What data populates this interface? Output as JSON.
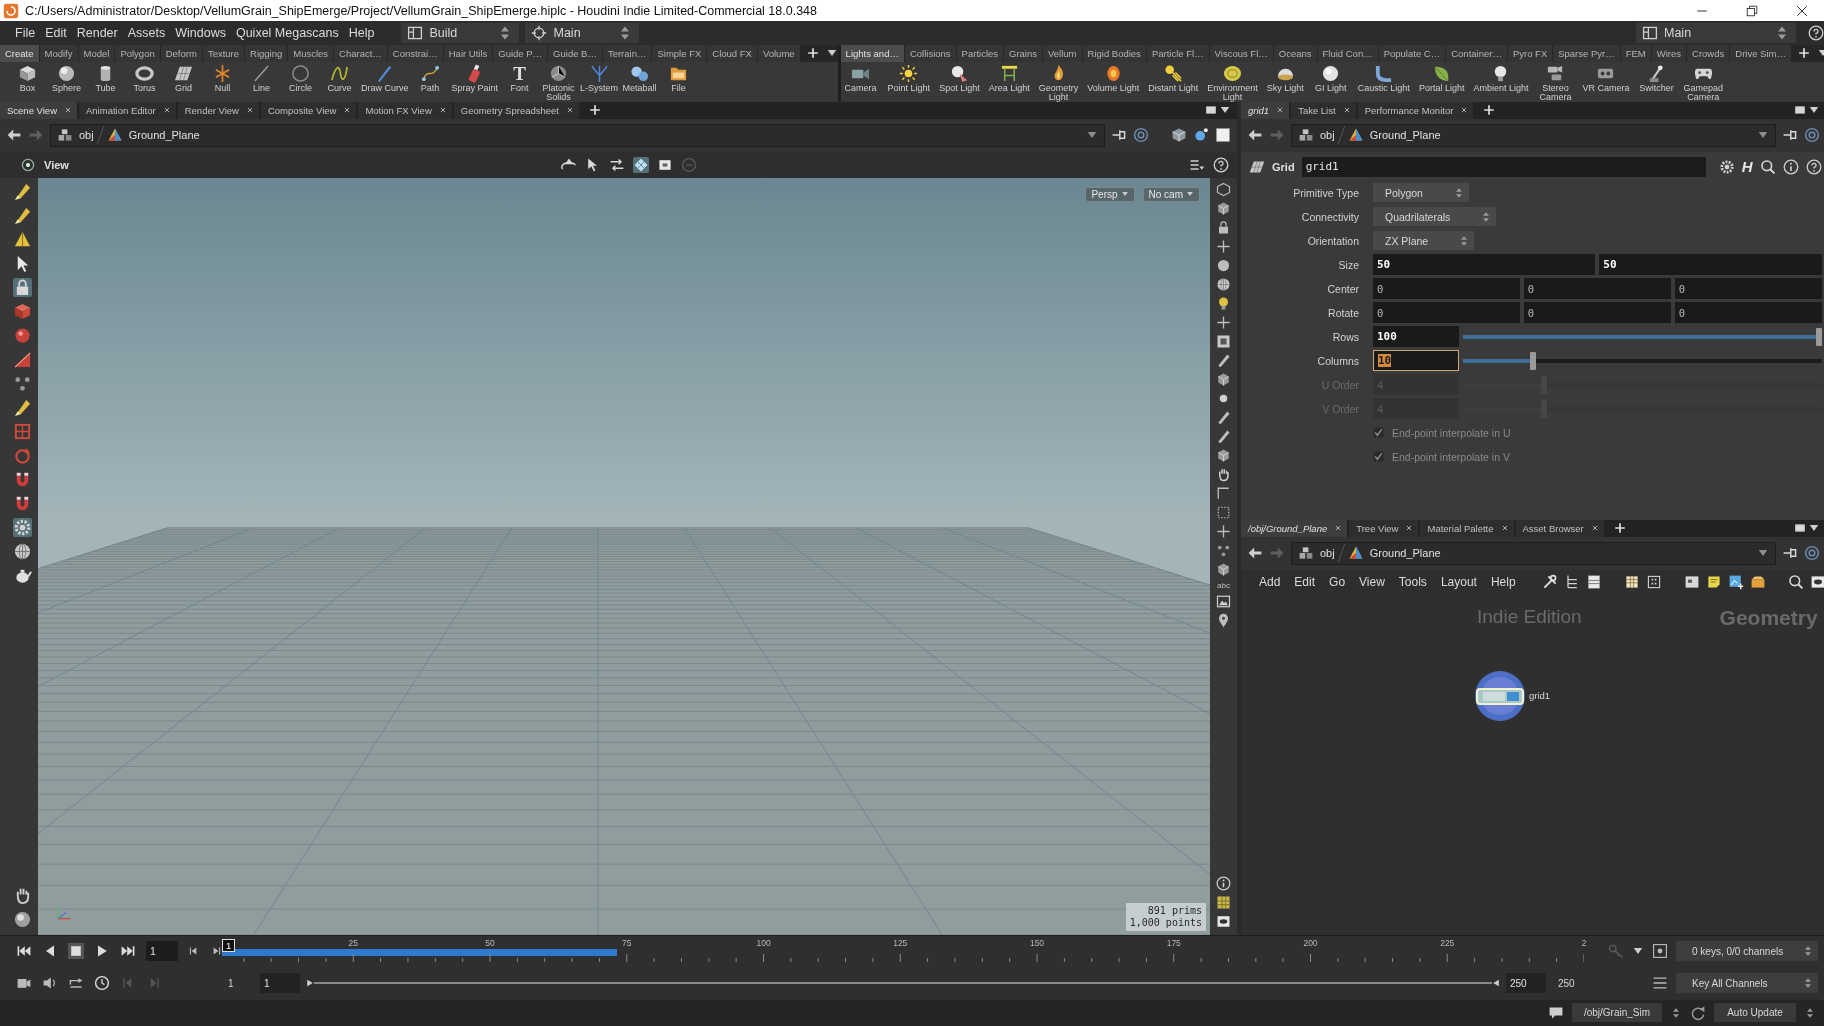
{
  "window": {
    "title": "C:/Users/Administrator/Desktop/VellumGrain_ShipEmerge/Project/VellumGrain_ShipEmerge.hiplc - Houdini Indie Limited-Commercial 18.0.348"
  },
  "menu_bar": {
    "items": [
      "File",
      "Edit",
      "Render",
      "Assets",
      "Windows",
      "Quixel Megascans",
      "Help"
    ],
    "desktop": "Build",
    "context": "Main",
    "right_desktop": "Main"
  },
  "shelves": [
    {
      "tabs": [
        {
          "label": "Create",
          "selected": true
        },
        {
          "label": "Modify",
          "selected": false
        },
        {
          "label": "Model",
          "selected": false
        },
        {
          "label": "Polygon",
          "selected": false
        },
        {
          "label": "Deform",
          "selected": false
        },
        {
          "label": "Texture",
          "selected": false
        },
        {
          "label": "Rigging",
          "selected": false
        },
        {
          "label": "Muscles",
          "selected": false
        },
        {
          "label": "Charact…",
          "selected": false
        },
        {
          "label": "Constrai…",
          "selected": false
        },
        {
          "label": "Hair Utils",
          "selected": false
        },
        {
          "label": "Guide P…",
          "selected": false
        },
        {
          "label": "Guide B…",
          "selected": false
        },
        {
          "label": "Terrain…",
          "selected": false
        },
        {
          "label": "Simple FX",
          "selected": false
        },
        {
          "label": "Cloud FX",
          "selected": false
        },
        {
          "label": "Volume",
          "selected": false
        }
      ],
      "tools": [
        {
          "label": "Box"
        },
        {
          "label": "Sphere"
        },
        {
          "label": "Tube"
        },
        {
          "label": "Torus"
        },
        {
          "label": "Grid"
        },
        {
          "label": "Null"
        },
        {
          "label": "Line"
        },
        {
          "label": "Circle"
        },
        {
          "label": "Curve"
        },
        {
          "label": "Draw Curve"
        },
        {
          "label": "Path"
        },
        {
          "label": "Spray Paint"
        },
        {
          "label": "Font",
          "glyph": "T"
        },
        {
          "label": "Platonic\nSolids"
        },
        {
          "label": "L-System"
        },
        {
          "label": "Metaball"
        },
        {
          "label": "File"
        }
      ]
    },
    {
      "tabs": [
        {
          "label": "Lights and…",
          "selected": true
        },
        {
          "label": "Collisions",
          "selected": false
        },
        {
          "label": "Particles",
          "selected": false
        },
        {
          "label": "Grains",
          "selected": false
        },
        {
          "label": "Vellum",
          "selected": false
        },
        {
          "label": "Rigid Bodies",
          "selected": false
        },
        {
          "label": "Particle Fl…",
          "selected": false
        },
        {
          "label": "Viscous Fl…",
          "selected": false
        },
        {
          "label": "Oceans",
          "selected": false
        },
        {
          "label": "Fluid Con…",
          "selected": false
        },
        {
          "label": "Populate C…",
          "selected": false
        },
        {
          "label": "Container…",
          "selected": false
        },
        {
          "label": "Pyro FX",
          "selected": false
        },
        {
          "label": "Sparse Pyr…",
          "selected": false
        },
        {
          "label": "FEM",
          "selected": false
        },
        {
          "label": "Wires",
          "selected": false
        },
        {
          "label": "Crowds",
          "selected": false
        },
        {
          "label": "Drive Sim…",
          "selected": false
        }
      ],
      "tools": [
        {
          "label": "Camera"
        },
        {
          "label": "Point Light"
        },
        {
          "label": "Spot Light"
        },
        {
          "label": "Area Light"
        },
        {
          "label": "Geometry\nLight"
        },
        {
          "label": "Volume Light"
        },
        {
          "label": "Distant Light"
        },
        {
          "label": "Environment\nLight"
        },
        {
          "label": "Sky Light"
        },
        {
          "label": "GI Light"
        },
        {
          "label": "Caustic Light"
        },
        {
          "label": "Portal Light"
        },
        {
          "label": "Ambient Light"
        },
        {
          "label": "Stereo\nCamera"
        },
        {
          "label": "VR Camera"
        },
        {
          "label": "Switcher"
        },
        {
          "label": "Gamepad\nCamera"
        }
      ]
    }
  ],
  "scene_pane": {
    "tabs": [
      {
        "label": "Scene View",
        "selected": true
      },
      {
        "label": "Animation Editor",
        "selected": false
      },
      {
        "label": "Render View",
        "selected": false
      },
      {
        "label": "Composite View",
        "selected": false
      },
      {
        "label": "Motion FX View",
        "selected": false
      },
      {
        "label": "Geometry Spreadsheet",
        "selected": false
      }
    ],
    "path": [
      "obj",
      "Ground_Plane"
    ],
    "view_label": "View",
    "view_tools": [
      {
        "selected": false
      },
      {
        "selected": false
      },
      {
        "selected": false
      },
      {
        "selected": true
      },
      {
        "selected": false
      },
      {
        "selected": false
      }
    ],
    "tools": [
      {
        "selected": false
      },
      {
        "selected": false
      },
      {
        "selected": false
      },
      {
        "selected": false
      },
      {
        "selected": true
      },
      {
        "selected": false
      },
      {
        "selected": false
      },
      {
        "selected": false
      },
      {
        "selected": false
      },
      {
        "selected": false
      },
      {
        "selected": false
      },
      {
        "selected": false
      },
      {
        "selected": false
      },
      {
        "selected": false
      },
      {
        "selected": true
      },
      {
        "selected": false
      },
      {
        "selected": false
      },
      {
        "selected": false
      },
      {
        "selected": false
      }
    ],
    "view_menus": [
      "Persp",
      "No cam"
    ],
    "stats": [
      "891 prims",
      "1,000 points"
    ],
    "toolbar_label": "abc"
  },
  "parameter_pane": {
    "tabs": [
      {
        "label": "grid1",
        "selected": true
      },
      {
        "label": "Take List",
        "selected": false
      },
      {
        "label": "Performance Monitor",
        "selected": false
      }
    ],
    "path": [
      "obj",
      "Ground_Plane"
    ],
    "node_type": "Grid",
    "node_name": "grid1",
    "asset_button": "H",
    "params": [
      {
        "kind": "menu",
        "label": "Primitive Type",
        "value": "Polygon",
        "disabled": false
      },
      {
        "kind": "menu",
        "label": "Connectivity",
        "value": "Quadrilaterals",
        "disabled": false
      },
      {
        "kind": "menu",
        "label": "Orientation",
        "value": "ZX Plane",
        "disabled": false
      },
      {
        "kind": "vector",
        "label": "Size",
        "values": [
          "50",
          "50"
        ],
        "modified": true,
        "disabled": false
      },
      {
        "kind": "vector",
        "label": "Center",
        "values": [
          "0",
          "0",
          "0"
        ],
        "modified": false,
        "disabled": false
      },
      {
        "kind": "vector",
        "label": "Rotate",
        "values": [
          "0",
          "0",
          "0"
        ],
        "modified": false,
        "disabled": false
      },
      {
        "kind": "slider",
        "label": "Rows",
        "value": "100",
        "level": 1,
        "focused": false,
        "modified": true,
        "disabled": false
      },
      {
        "kind": "slider",
        "label": "Columns",
        "value": "10",
        "level": 0.19,
        "focused": true,
        "modified": true,
        "disabled": false
      },
      {
        "kind": "slider",
        "label": "U Order",
        "value": "4",
        "level": 0.22,
        "focused": false,
        "modified": false,
        "disabled": true
      },
      {
        "kind": "slider",
        "label": "V Order",
        "value": "4",
        "level": 0.22,
        "focused": false,
        "modified": false,
        "disabled": true
      },
      {
        "kind": "checkbox",
        "label": "End-point interpolate in U",
        "checked": true,
        "disabled": true
      },
      {
        "kind": "checkbox",
        "label": "End-point interpolate in V",
        "checked": true,
        "disabled": true
      }
    ]
  },
  "network_pane": {
    "tabs": [
      {
        "label": "/obj/Ground_Plane",
        "selected": true
      },
      {
        "label": "Tree View",
        "selected": false
      },
      {
        "label": "Material Palette",
        "selected": false
      },
      {
        "label": "Asset Browser",
        "selected": false
      }
    ],
    "path": [
      "obj",
      "Ground_Plane"
    ],
    "menus": [
      "Add",
      "Edit",
      "Go",
      "View",
      "Tools",
      "Layout",
      "Help"
    ],
    "edition_label": "Indie Edition",
    "context_label": "Geometry",
    "nodes": [
      {
        "name": "grid1",
        "selected": true
      }
    ]
  },
  "timeline": {
    "frame": "1",
    "current_frame": "1",
    "ticks": [
      "25",
      "50",
      "75",
      "100",
      "125",
      "150",
      "175",
      "200",
      "225",
      "2"
    ],
    "cached": {
      "level": 0.29
    },
    "range": [
      "1",
      "1",
      "250",
      "250"
    ],
    "keys_info": "0 keys, 0/0 channels",
    "key_menu": "Key All Channels"
  },
  "status_bar": {
    "network_path": "/obj/Grain_Sim",
    "update_mode": "Auto Update"
  }
}
